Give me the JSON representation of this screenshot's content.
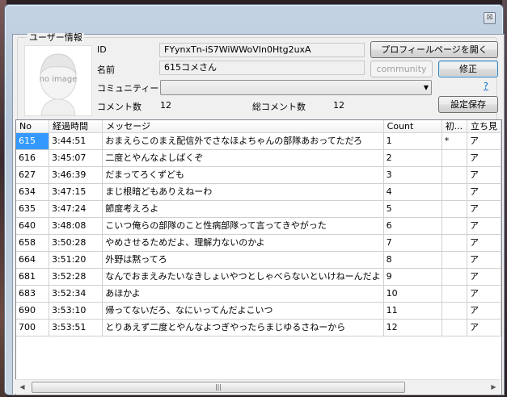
{
  "window": {
    "close_label": "☒"
  },
  "user_info": {
    "group_title": "ユーザー情報",
    "no_image_text": "no image",
    "id_label": "ID",
    "id_value": "FYynxTn-iS7WiWWoVIn0Htg2uxA",
    "name_label": "名前",
    "name_value": "615コメさん",
    "community_label": "コミュニティー",
    "community_value": "",
    "comment_count_label": "コメント数",
    "comment_count_value": "12",
    "total_comment_label": "総コメント数",
    "total_comment_value": "12",
    "profile_button": "プロフィールページを開く",
    "community_button": "community",
    "edit_button": "修正",
    "help_link": "?",
    "save_settings_button": "設定保存"
  },
  "table": {
    "headers": [
      "No",
      "経過時間",
      "メッセージ",
      "Count",
      "初...",
      "立ち見"
    ],
    "rows": [
      {
        "no": "615",
        "time": "3:44:51",
        "message": "おまえらこのまえ配信外でさなほよちゃんの部隊あおってただろ",
        "count": "1",
        "first": "*",
        "tachimi": "ア"
      },
      {
        "no": "616",
        "time": "3:45:07",
        "message": "二度とやんなよしばくぞ",
        "count": "2",
        "first": "",
        "tachimi": "ア"
      },
      {
        "no": "627",
        "time": "3:46:39",
        "message": "だまってろくずども",
        "count": "3",
        "first": "",
        "tachimi": "ア"
      },
      {
        "no": "634",
        "time": "3:47:15",
        "message": "まじ根暗どもありえねーわ",
        "count": "4",
        "first": "",
        "tachimi": "ア"
      },
      {
        "no": "635",
        "time": "3:47:24",
        "message": "節度考えろよ",
        "count": "5",
        "first": "",
        "tachimi": "ア"
      },
      {
        "no": "640",
        "time": "3:48:08",
        "message": "こいつ俺らの部隊のこと性病部隊って言ってきやがった",
        "count": "6",
        "first": "",
        "tachimi": "ア"
      },
      {
        "no": "658",
        "time": "3:50:28",
        "message": "やめさせるためだよ、理解力ないのかよ",
        "count": "7",
        "first": "",
        "tachimi": "ア"
      },
      {
        "no": "664",
        "time": "3:51:20",
        "message": "外野は黙ってろ",
        "count": "8",
        "first": "",
        "tachimi": "ア"
      },
      {
        "no": "681",
        "time": "3:52:28",
        "message": "なんでおまえみたいなきしょいやつとしゃべらないといけねーんだよ",
        "count": "9",
        "first": "",
        "tachimi": "ア"
      },
      {
        "no": "683",
        "time": "3:52:34",
        "message": "あほかよ",
        "count": "10",
        "first": "",
        "tachimi": "ア"
      },
      {
        "no": "690",
        "time": "3:53:10",
        "message": "帰ってないだろ、なにいってんだよこいつ",
        "count": "11",
        "first": "",
        "tachimi": "ア"
      },
      {
        "no": "700",
        "time": "3:53:51",
        "message": "とりあえず二度とやんなよつぎやったらまじゆるさねーから",
        "count": "12",
        "first": "",
        "tachimi": "ア"
      }
    ]
  },
  "scrollbar": {
    "left_arrow": "◀",
    "right_arrow": "▶",
    "grip": "|||"
  }
}
